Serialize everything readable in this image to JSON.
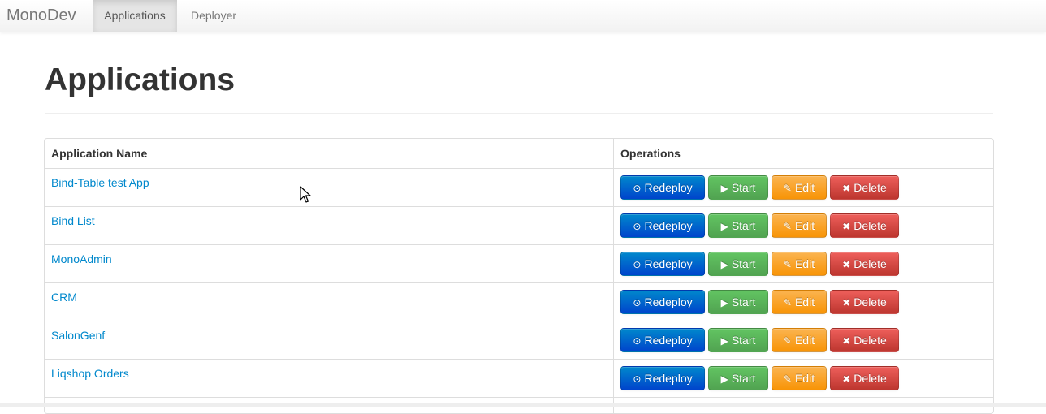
{
  "navbar": {
    "brand": "MonoDev",
    "items": [
      {
        "label": "Applications",
        "active": true
      },
      {
        "label": "Deployer",
        "active": false
      }
    ]
  },
  "page": {
    "title": "Applications"
  },
  "table": {
    "columns": [
      "Application Name",
      "Operations"
    ],
    "buttons": {
      "redeploy": "Redeploy",
      "start": "Start",
      "edit": "Edit",
      "delete": "Delete"
    },
    "rows": [
      {
        "name": "Bind-Table test App"
      },
      {
        "name": "Bind List"
      },
      {
        "name": "MonoAdmin"
      },
      {
        "name": "CRM"
      },
      {
        "name": "SalonGenf"
      },
      {
        "name": "Liqshop Orders"
      }
    ]
  },
  "colors": {
    "link": "#0088cc",
    "redeploy": "#0044cc",
    "start": "#51a351",
    "edit": "#f89406",
    "delete": "#bd362f"
  },
  "icons": {
    "redeploy": "circle-arrow-up-icon",
    "start": "play-icon",
    "edit": "edit-icon",
    "delete": "trash-icon"
  }
}
